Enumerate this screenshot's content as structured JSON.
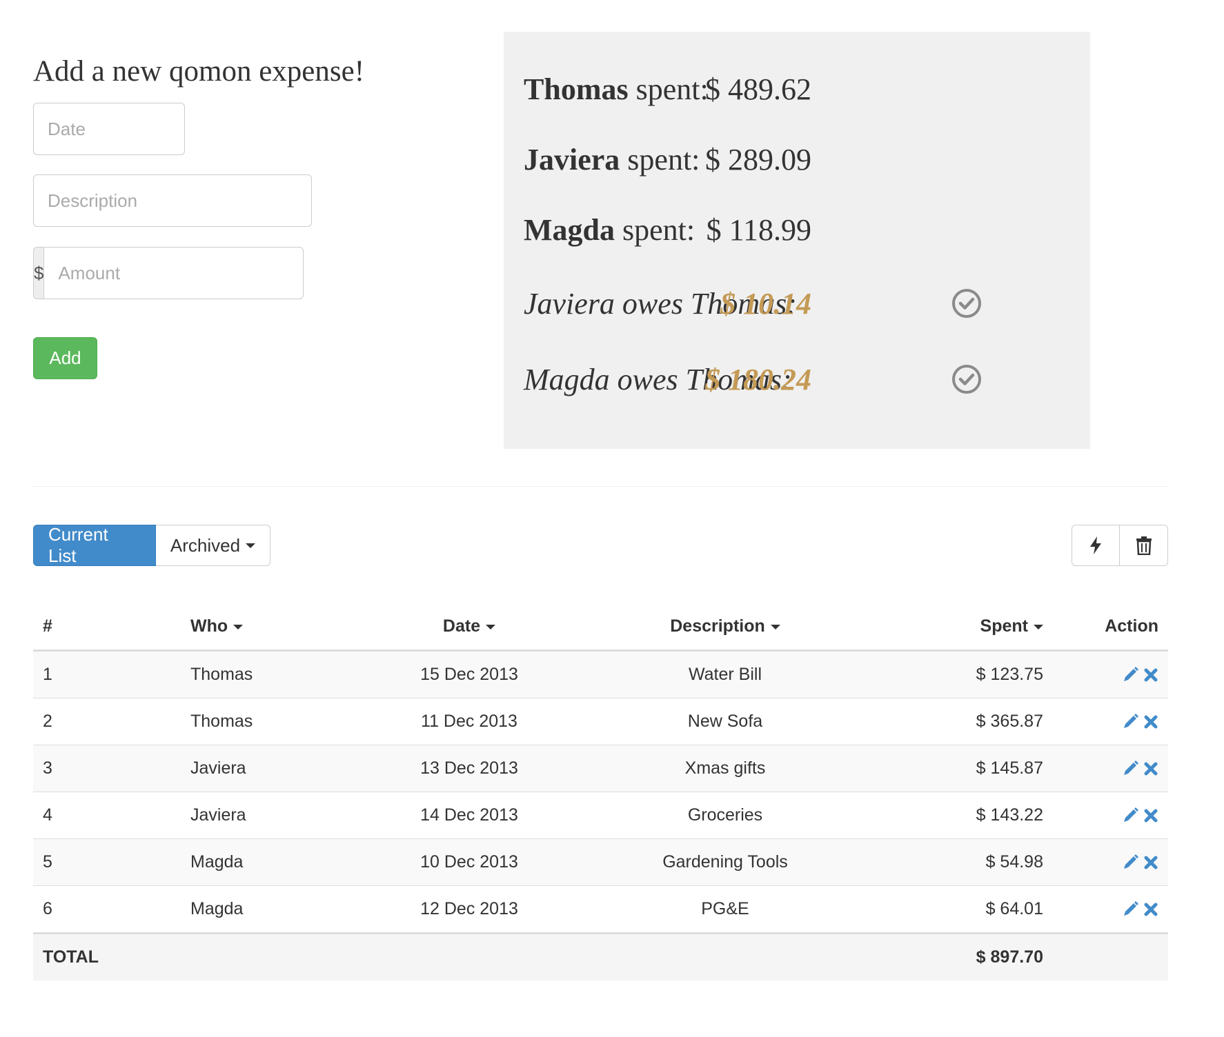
{
  "form": {
    "title": "Add a new qomon expense!",
    "date_placeholder": "Date",
    "description_placeholder": "Description",
    "currency_symbol": "$",
    "amount_placeholder": "Amount",
    "add_label": "Add"
  },
  "summary": {
    "spent": [
      {
        "name": "Thomas",
        "suffix": " spent:",
        "amount": "$ 489.62"
      },
      {
        "name": "Javiera",
        "suffix": " spent:",
        "amount": "$ 289.09"
      },
      {
        "name": "Magda",
        "suffix": " spent:",
        "amount": "$ 118.99"
      }
    ],
    "owes": [
      {
        "label": "Javiera owes Thomas:",
        "amount": "$ 10.14",
        "icon": "check-circle-icon"
      },
      {
        "label": "Magda owes Thomas:",
        "amount": "$ 180.24",
        "icon": "check-circle-icon"
      }
    ]
  },
  "tabs": {
    "current": "Current List",
    "archived": "Archived"
  },
  "toolbar": {
    "bolt_icon": "bolt-icon",
    "trash_icon": "trash-icon"
  },
  "table": {
    "headers": {
      "num": "#",
      "who": "Who",
      "date": "Date",
      "description": "Description",
      "spent": "Spent",
      "action": "Action"
    },
    "rows": [
      {
        "num": "1",
        "who": "Thomas",
        "date": "15 Dec 2013",
        "description": "Water Bill",
        "spent": "$ 123.75"
      },
      {
        "num": "2",
        "who": "Thomas",
        "date": "11 Dec 2013",
        "description": "New Sofa",
        "spent": "$ 365.87"
      },
      {
        "num": "3",
        "who": "Javiera",
        "date": "13 Dec 2013",
        "description": "Xmas gifts",
        "spent": "$ 145.87"
      },
      {
        "num": "4",
        "who": "Javiera",
        "date": "14 Dec 2013",
        "description": "Groceries",
        "spent": "$ 143.22"
      },
      {
        "num": "5",
        "who": "Magda",
        "date": "10 Dec 2013",
        "description": "Gardening Tools",
        "spent": "$ 54.98"
      },
      {
        "num": "6",
        "who": "Magda",
        "date": "12 Dec 2013",
        "description": "PG&E",
        "spent": "$ 64.01"
      }
    ],
    "total_label": "TOTAL",
    "total_value": "$ 897.70"
  },
  "colors": {
    "primary": "#428bca",
    "success": "#5cb85c",
    "owed_amount": "#c49a55",
    "summary_bg": "#f0f0f0"
  }
}
